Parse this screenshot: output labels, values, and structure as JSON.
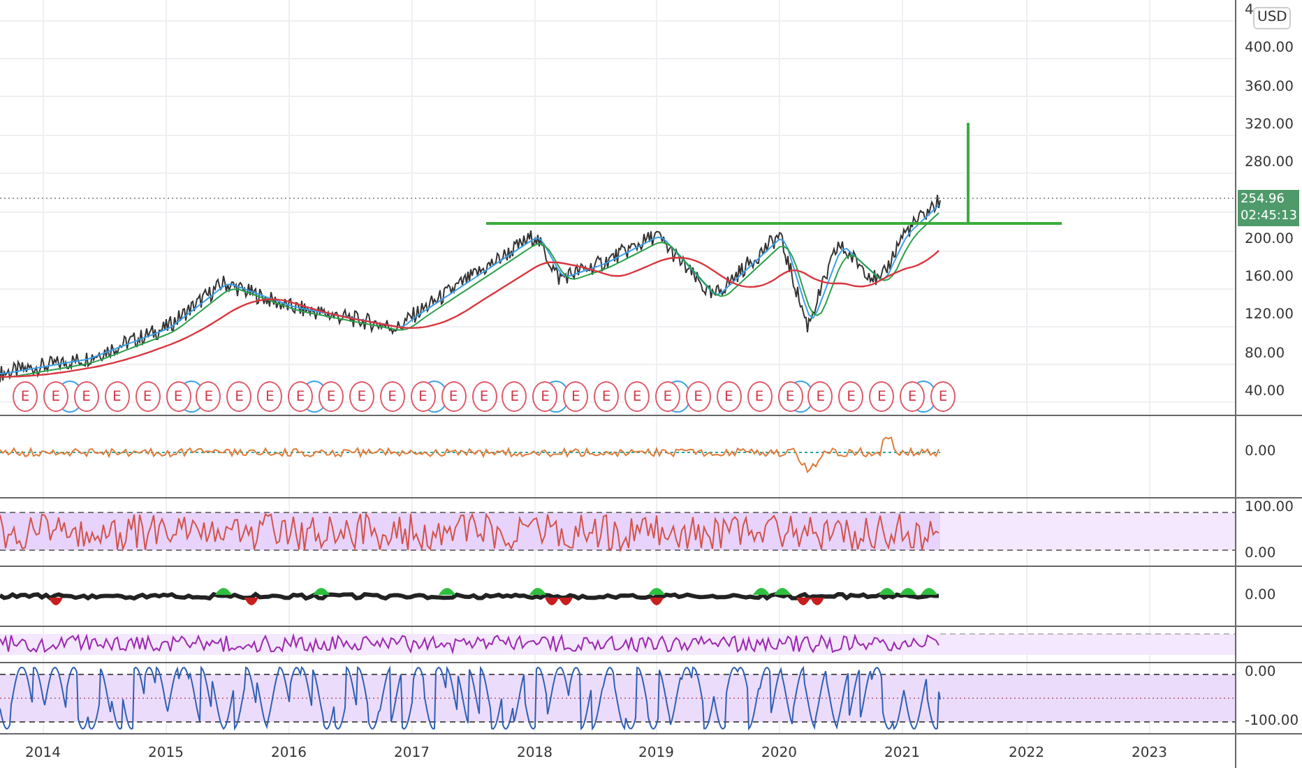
{
  "price_axis": {
    "currency": "USD",
    "labels": [
      "4",
      "400.00",
      "360.00",
      "320.00",
      "280.00",
      "200.00",
      "160.00",
      "120.00",
      "80.00",
      "40.00"
    ]
  },
  "last_price": {
    "price": "254.96",
    "countdown": "02:45:13"
  },
  "earnings": [
    "E",
    "E",
    "E",
    "E",
    "E",
    "E",
    "E",
    "E",
    "E",
    "E",
    "E",
    "E",
    "E",
    "E",
    "E",
    "E",
    "E",
    "E",
    "E",
    "E",
    "E",
    "E",
    "E",
    "E",
    "E",
    "E",
    "E",
    "E",
    "E",
    "E",
    "E"
  ],
  "panes": [
    {
      "kind": "oscillator",
      "labels": [
        "0.00"
      ]
    },
    {
      "kind": "band",
      "labels": [
        "100.00",
        "0.00"
      ]
    },
    {
      "kind": "histogram",
      "labels": [
        "0.00"
      ]
    },
    {
      "kind": "light-band"
    },
    {
      "kind": "stochastic",
      "labels": [
        "0.00",
        "-100.00"
      ]
    }
  ],
  "time_axis": [
    "2014",
    "2015",
    "2016",
    "2017",
    "2018",
    "2019",
    "2020",
    "2021",
    "2022",
    "2023"
  ]
}
